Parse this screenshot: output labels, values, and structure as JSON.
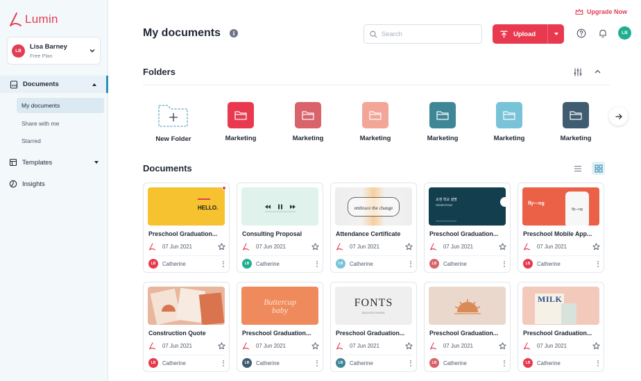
{
  "app": {
    "logo_text": "Lumin",
    "upgrade_label": "Upgrade Now"
  },
  "user": {
    "name": "Lisa Barney",
    "plan": "Free Plan",
    "initials": "LB"
  },
  "sidebar": {
    "documents": "Documents",
    "sub_items": [
      "My documents",
      "Share with me",
      "Starred"
    ],
    "templates": "Templates",
    "insights": "Insights"
  },
  "header": {
    "title": "My documents",
    "search_placeholder": "Search",
    "upload_label": "Upload"
  },
  "folders": {
    "title": "Folders",
    "new_folder": "New Folder",
    "items": [
      {
        "name": "Marketing",
        "color": "#e8394f"
      },
      {
        "name": "Marketing",
        "color": "#d9636b"
      },
      {
        "name": "Marketing",
        "color": "#f3a597"
      },
      {
        "name": "Marketing",
        "color": "#3f8796"
      },
      {
        "name": "Marketing",
        "color": "#79c3d8"
      },
      {
        "name": "Marketing",
        "color": "#3f5c70"
      }
    ]
  },
  "documents": {
    "title": "Documents",
    "items": [
      {
        "title": "Preschool Graduation...",
        "date": "07 Jun 2021",
        "owner": "Catherine",
        "owner_color": "#e8394f"
      },
      {
        "title": "Consulting Proposal",
        "date": "07 Jun 2021",
        "owner": "Catherine",
        "owner_color": "#20ae91"
      },
      {
        "title": "Attendance Certificate",
        "date": "07 Jun 2021",
        "owner": "Catherine",
        "owner_color": "#79c3d8"
      },
      {
        "title": "Preschool Graduation...",
        "date": "07 Jun 2021",
        "owner": "Catherine",
        "owner_color": "#d9636b"
      },
      {
        "title": "Preschool Mobile App...",
        "date": "07 Jun 2021",
        "owner": "Catherine",
        "owner_color": "#e8394f"
      },
      {
        "title": "Construction Quote",
        "date": "07 Jun 2021",
        "owner": "Catherine",
        "owner_color": "#e8394f"
      },
      {
        "title": "Preschool Graduation...",
        "date": "07 Jun 2021",
        "owner": "Catherine",
        "owner_color": "#3f5c70"
      },
      {
        "title": "Preschool Graduation...",
        "date": "07 Jun 2021",
        "owner": "Catherine",
        "owner_color": "#3f8796"
      },
      {
        "title": "Preschool Graduation...",
        "date": "07 Jun 2021",
        "owner": "Catherine",
        "owner_color": "#d9636b"
      },
      {
        "title": "Preschool Graduation...",
        "date": "07 Jun 2021",
        "owner": "Catherine",
        "owner_color": "#e8394f"
      }
    ]
  },
  "thumbnails": {
    "hello": "HELLO.",
    "embrace": "embrace the change",
    "poster_title": "교생 학교 설명",
    "poster_sub": "CESEVOLE",
    "app_brand": "fly—ng",
    "app_tag": "fly—ng",
    "buttercup_1": "Buttercup",
    "buttercup_2": "baby",
    "fonts": "FONTS",
    "fonts_sub": "NEUESCHAMS",
    "milk": "MILK"
  }
}
